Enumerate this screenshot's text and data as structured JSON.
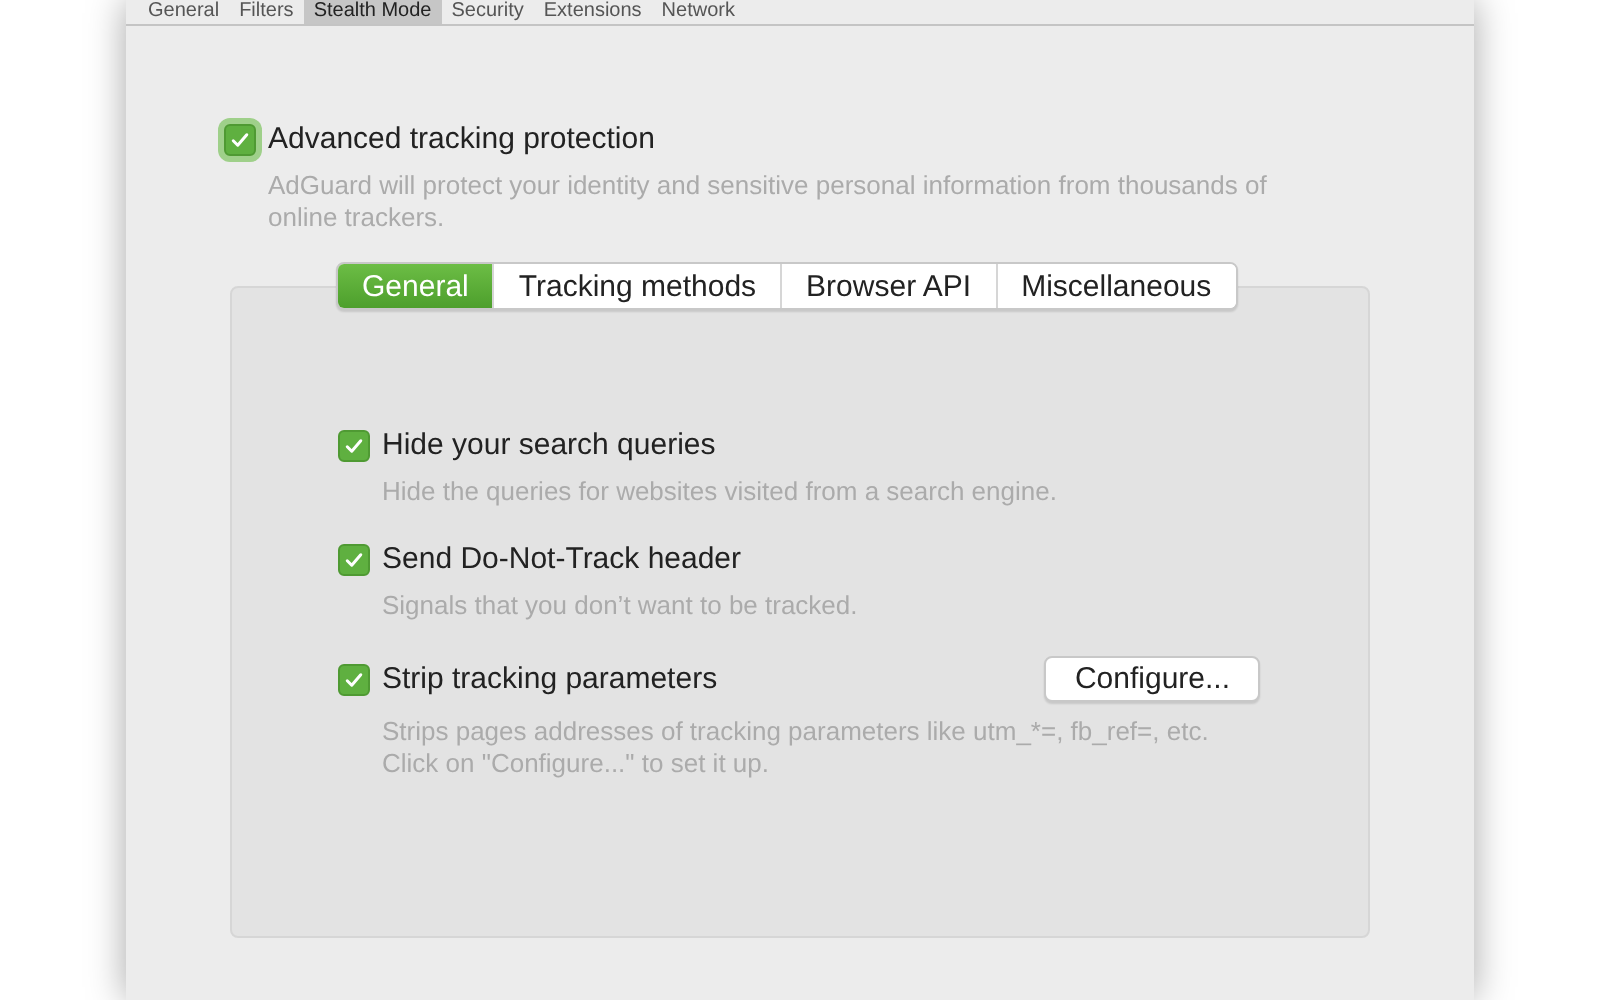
{
  "top_tabs": [
    {
      "label": "General",
      "selected": false
    },
    {
      "label": "Filters",
      "selected": false
    },
    {
      "label": "Stealth Mode",
      "selected": true
    },
    {
      "label": "Security",
      "selected": false
    },
    {
      "label": "Extensions",
      "selected": false
    },
    {
      "label": "Network",
      "selected": false
    }
  ],
  "main_option": {
    "label": "Advanced tracking protection",
    "checked": true,
    "description": "AdGuard will protect your identity and sensitive personal information from thousands of online trackers."
  },
  "segments": [
    {
      "label": "General",
      "selected": true
    },
    {
      "label": "Tracking methods",
      "selected": false
    },
    {
      "label": "Browser API",
      "selected": false
    },
    {
      "label": "Miscellaneous",
      "selected": false
    }
  ],
  "options": [
    {
      "label": "Hide your search queries",
      "checked": true,
      "description": "Hide the queries for websites visited from a search engine."
    },
    {
      "label": "Send Do-Not-Track header",
      "checked": true,
      "description": "Signals that you don’t want to be tracked."
    },
    {
      "label": "Strip tracking parameters",
      "checked": true,
      "description": "Strips pages addresses of tracking parameters like utm_*=, fb_ref=, etc.\nClick on \"Configure...\" to set it up.",
      "button": "Configure..."
    }
  ]
}
